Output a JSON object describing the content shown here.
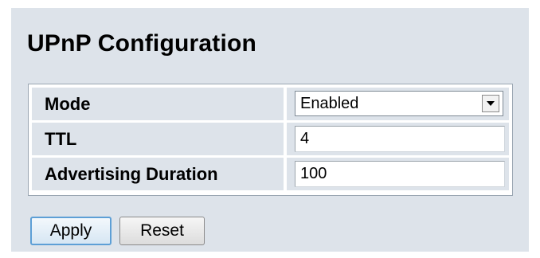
{
  "page": {
    "title": "UPnP Configuration"
  },
  "config": {
    "rows": [
      {
        "label": "Mode",
        "value": "Enabled",
        "type": "select"
      },
      {
        "label": "TTL",
        "value": "4",
        "type": "text"
      },
      {
        "label": "Advertising Duration",
        "value": "100",
        "type": "text"
      }
    ]
  },
  "buttons": {
    "apply_label": "Apply",
    "reset_label": "Reset"
  },
  "colors": {
    "panel_bg": "#dde3ea",
    "apply_focus_border": "#5d9fd6"
  },
  "icons": {
    "select_arrow": "chevron-down-icon"
  }
}
